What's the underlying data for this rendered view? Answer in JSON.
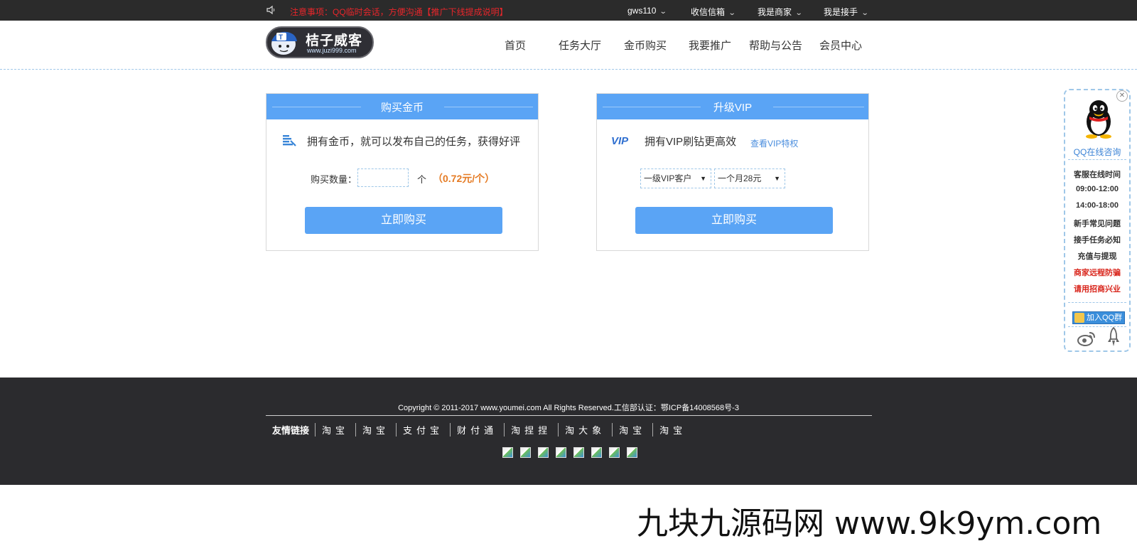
{
  "topbar": {
    "notice": "注意事项：QQ临时会话，方便沟通【推广下线提成说明】",
    "menus": [
      "gws110",
      "收信信箱",
      "我是商家",
      "我是接手"
    ]
  },
  "header": {
    "logo_title": "桔子威客",
    "logo_url": "www.juzi999.com",
    "nav": [
      "首页",
      "任务大厅",
      "金币购买",
      "我要推广",
      "帮助与公告",
      "会员中心"
    ]
  },
  "gold_panel": {
    "title": "购买金币",
    "desc": "拥有金币，就可以发布自己的任务，获得好评",
    "qty_label": "购买数量：",
    "qty_value": "",
    "unit": "个",
    "price": "（0.72元/个）",
    "button": "立即购买"
  },
  "vip_panel": {
    "title": "升级VIP",
    "badge": "VIP",
    "desc": "拥有VIP刷钻更高效",
    "link": "查看VIP特权",
    "level_select": "一级VIP客户",
    "period_select": "一个月28元",
    "button": "立即购买"
  },
  "side_widget": {
    "consult": "QQ在线咨询",
    "items": [
      "客服在线时间",
      "09:00-12:00",
      "14:00-18:00",
      "新手常见问题",
      "接手任务必知",
      "充值与提现"
    ],
    "red_items": [
      "商家远程防骗",
      "请用招商兴业"
    ],
    "qq_group": "加入QQ群"
  },
  "footer": {
    "copyright": "Copyright © 2011-2017 www.youmei.com All Rights Reserved.工信部认证：鄂ICP备14008568号-3",
    "links_label": "友情链接",
    "links": [
      "淘宝",
      "淘宝",
      "支付宝",
      "财付通",
      "淘捏捏",
      "淘大象",
      "淘宝",
      "淘宝"
    ],
    "badge_count": 8
  },
  "watermark": "九块九源码网 www.9k9ym.com",
  "colors": {
    "accent": "#5aa4f5",
    "topbar_bg": "#2b2b2b",
    "notice_red": "#e8262b",
    "price_orange": "#e57b24"
  }
}
